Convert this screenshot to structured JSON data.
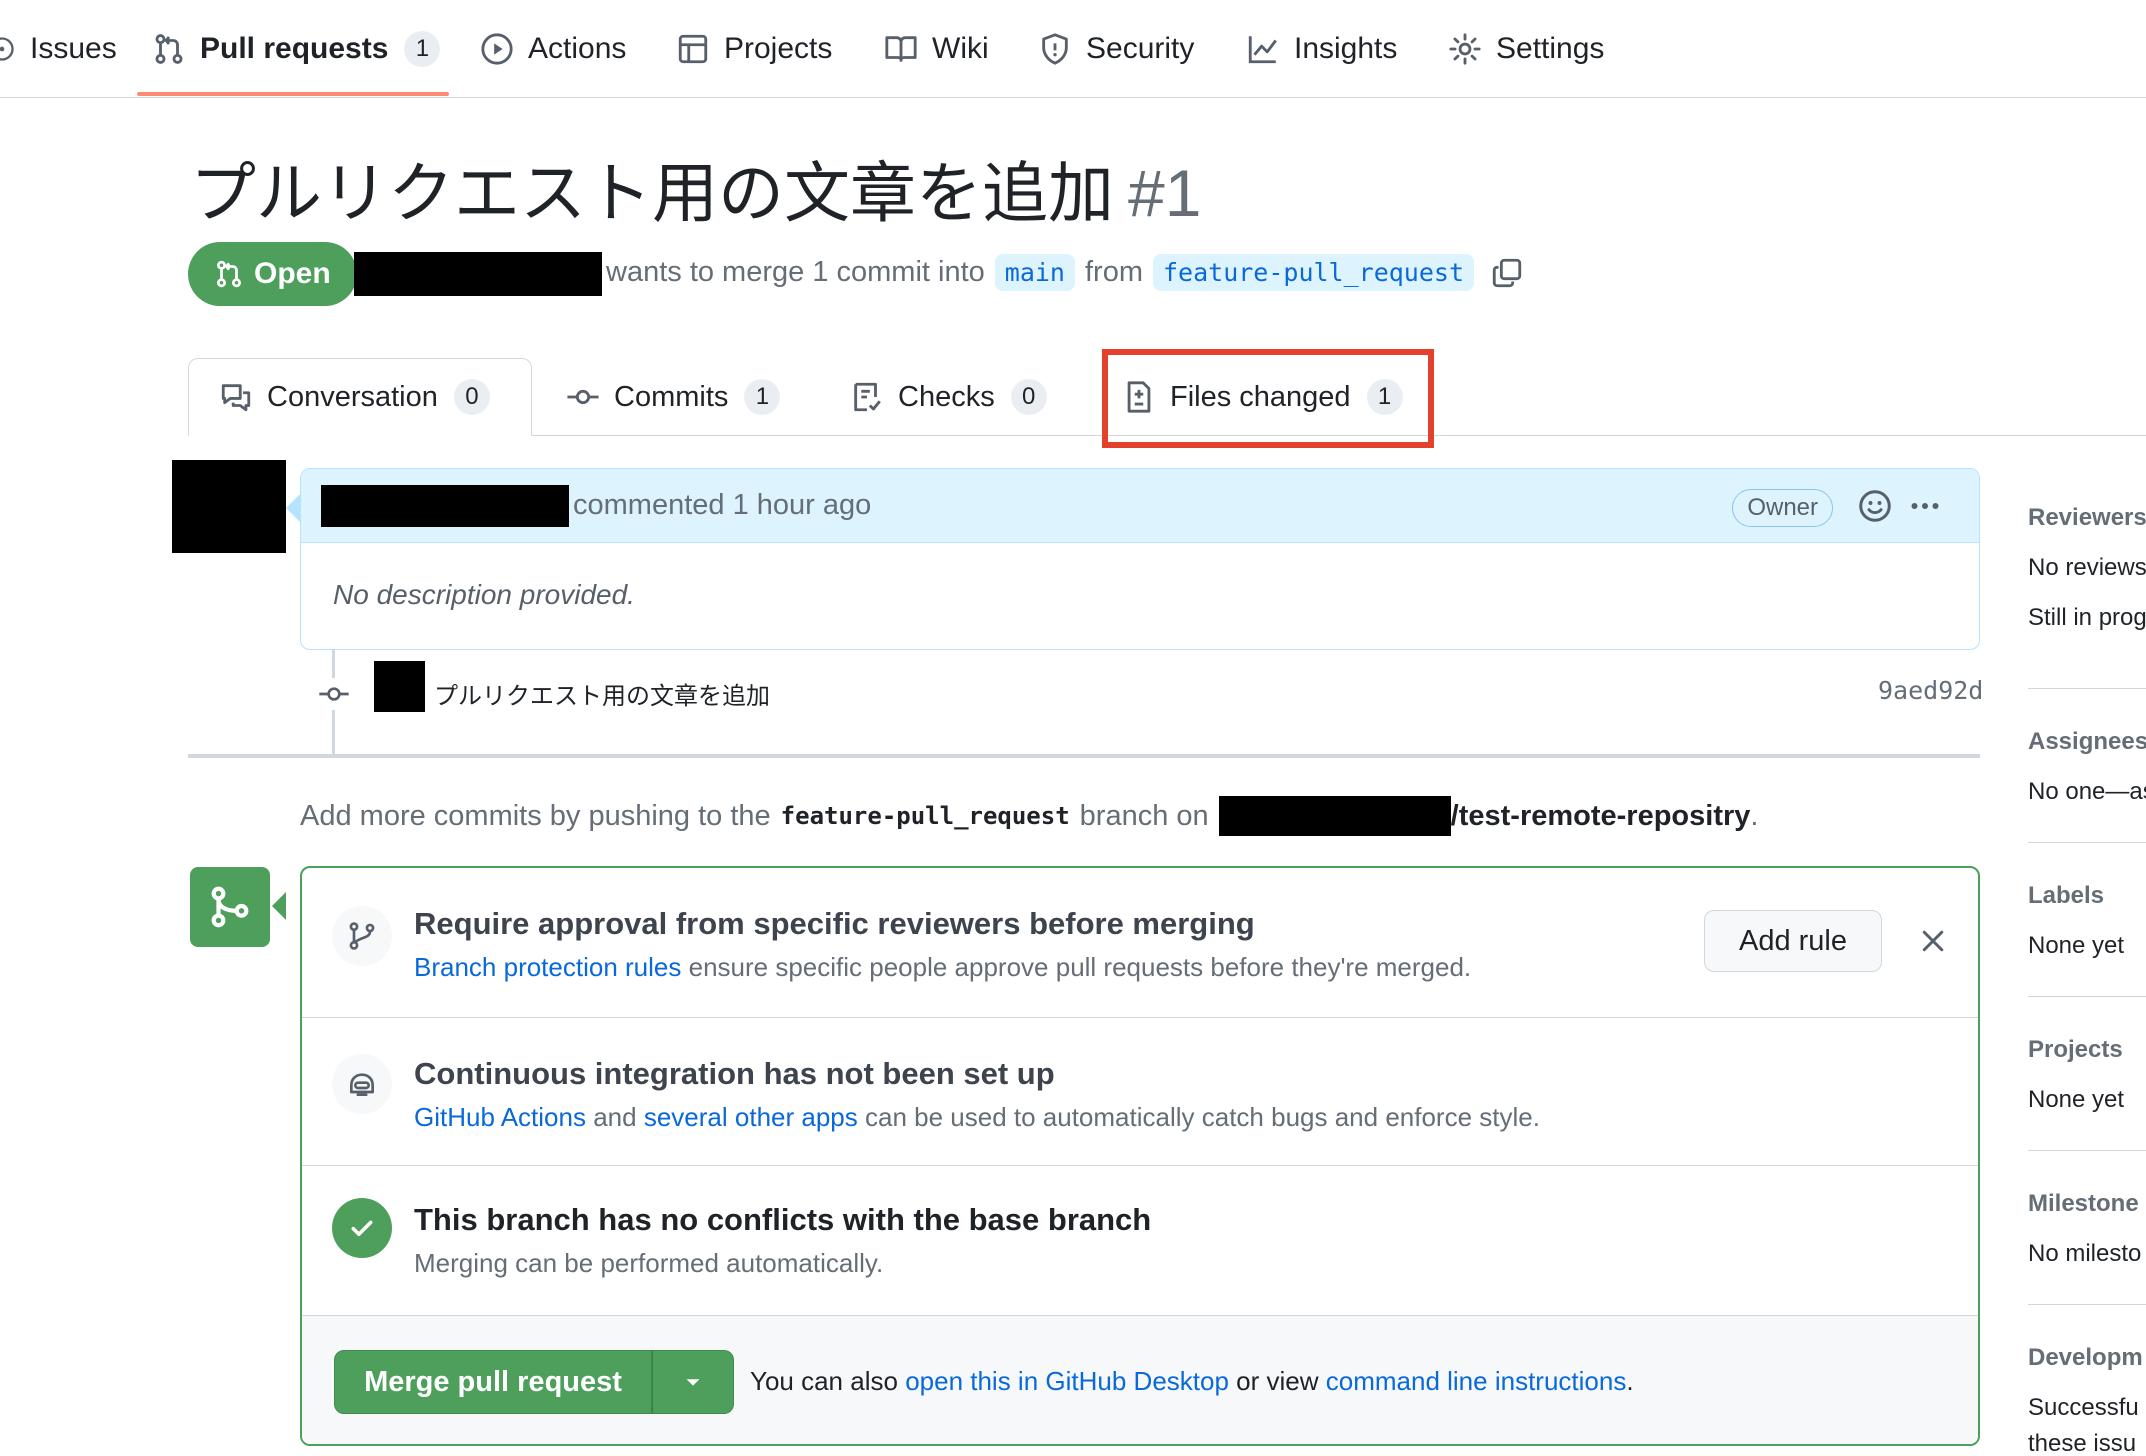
{
  "repo_nav": {
    "items": [
      {
        "label": "Issues",
        "icon": "issue-icon"
      },
      {
        "label": "Pull requests",
        "icon": "git-pull-request-icon",
        "count": "1",
        "active": true
      },
      {
        "label": "Actions",
        "icon": "play-icon"
      },
      {
        "label": "Projects",
        "icon": "table-icon"
      },
      {
        "label": "Wiki",
        "icon": "book-icon"
      },
      {
        "label": "Security",
        "icon": "shield-icon"
      },
      {
        "label": "Insights",
        "icon": "graph-icon"
      },
      {
        "label": "Settings",
        "icon": "gear-icon"
      }
    ]
  },
  "pr": {
    "title": "プルリクエスト用の文章を追加",
    "number": "#1",
    "state": "Open",
    "meta_text": "wants to merge 1 commit into",
    "base_branch": "main",
    "from_text": "from",
    "head_branch": "feature-pull_request"
  },
  "tabs": [
    {
      "label": "Conversation",
      "count": "0",
      "icon": "comment-discussion-icon",
      "selected": true
    },
    {
      "label": "Commits",
      "count": "1",
      "icon": "commit-icon"
    },
    {
      "label": "Checks",
      "count": "0",
      "icon": "checklist-icon"
    },
    {
      "label": "Files changed",
      "count": "1",
      "icon": "file-diff-icon",
      "highlighted": true
    }
  ],
  "comment": {
    "action": "commented 1 hour ago",
    "role": "Owner",
    "body": "No description provided."
  },
  "commit": {
    "message": "プルリクエスト用の文章を追加",
    "sha": "9aed92d"
  },
  "push_note": {
    "prefix": "Add more commits by pushing to the",
    "branch": "feature-pull_request",
    "middle": "branch on",
    "repo": "/test-remote-repositry",
    "suffix": "."
  },
  "merge_box": {
    "approval": {
      "title": "Require approval from specific reviewers before merging",
      "link": "Branch protection rules",
      "text": "ensure specific people approve pull requests before they're merged.",
      "button": "Add rule"
    },
    "ci": {
      "title": "Continuous integration has not been set up",
      "link1": "GitHub Actions",
      "and": "and",
      "link2": "several other apps",
      "text": "can be used to automatically catch bugs and enforce style."
    },
    "conflicts": {
      "title": "This branch has no conflicts with the base branch",
      "text": "Merging can be performed automatically."
    },
    "footer": {
      "merge_button": "Merge pull request",
      "also": "You can also",
      "link1": "open this in GitHub Desktop",
      "or_view": "or view",
      "link2": "command line instructions",
      "end": "."
    }
  },
  "sidebar": {
    "sections": [
      {
        "heading": "Reviewers",
        "values": [
          "No reviews",
          "Still in prog"
        ]
      },
      {
        "heading": "Assignees",
        "values": [
          "No one—as"
        ]
      },
      {
        "heading": "Labels",
        "values": [
          "None yet"
        ]
      },
      {
        "heading": "Projects",
        "values": [
          "None yet"
        ]
      },
      {
        "heading": "Milestone",
        "values": [
          "No milesto"
        ]
      },
      {
        "heading": "Developm",
        "values": [
          "Successfu",
          "these issu"
        ]
      }
    ]
  },
  "colors": {
    "open_green": "#4e9f5c",
    "link_blue": "#0969da",
    "highlight_red": "#e2412b",
    "nav_underline": "#fd8c73"
  }
}
